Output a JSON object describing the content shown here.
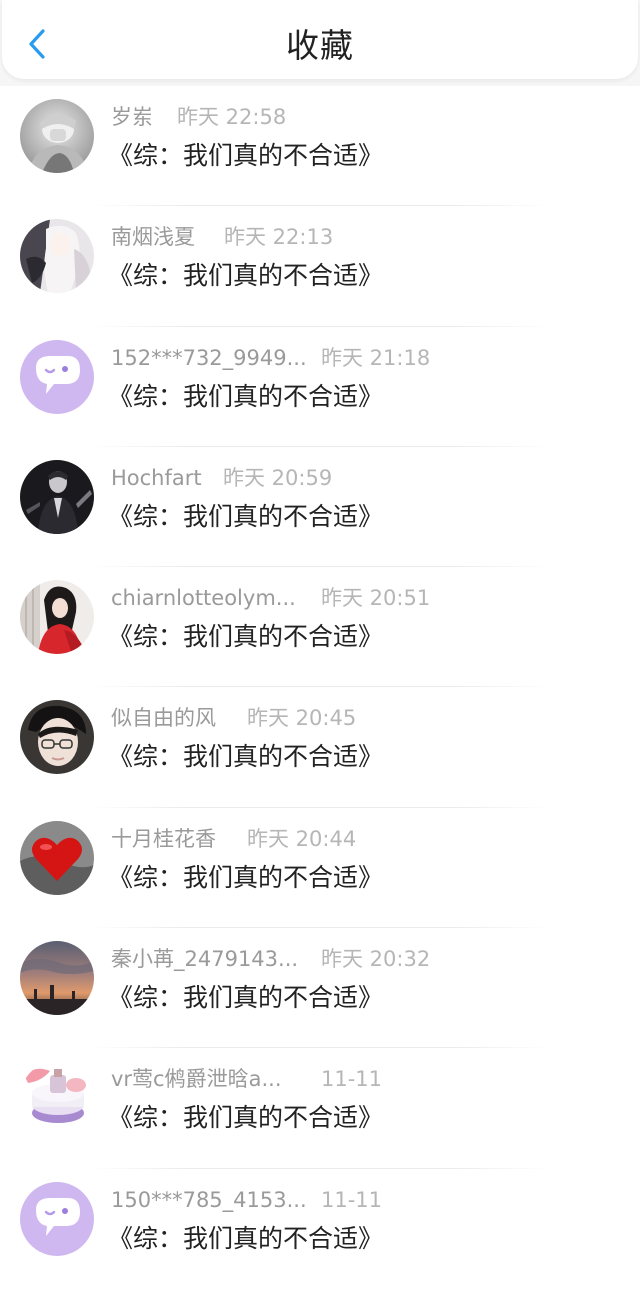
{
  "header": {
    "title": "收藏",
    "back_icon": "chevron-left-icon",
    "accent_color": "#2a9cf0"
  },
  "items": [
    {
      "user": "岁岽",
      "time": "昨天 22:58",
      "book": "《综：我们真的不合适》",
      "avatar": "photo-grey-hooded-figure"
    },
    {
      "user": "南烟浅夏",
      "time": "昨天 22:13",
      "book": "《综：我们真的不合适》",
      "avatar": "photo-anime-girl"
    },
    {
      "user": "152***732_9949...",
      "time": "昨天 21:18",
      "book": "《综：我们真的不合适》",
      "avatar": "default-chat-bubble-avatar"
    },
    {
      "user": "Hochfart",
      "time": "昨天 20:59",
      "book": "《综：我们真的不合适》",
      "avatar": "photo-dark-suited-man"
    },
    {
      "user": "chiarnlotteolym...",
      "time": "昨天 20:51",
      "book": "《综：我们真的不合适》",
      "avatar": "photo-girl-red-dress"
    },
    {
      "user": "似自由的风",
      "time": "昨天 20:45",
      "book": "《综：我们真的不合适》",
      "avatar": "photo-young-man-glasses"
    },
    {
      "user": "十月桂花香",
      "time": "昨天 20:44",
      "book": "《综：我们真的不合适》",
      "avatar": "photo-red-heart"
    },
    {
      "user": "秦小苒_2479143...",
      "time": "昨天 20:32",
      "book": "《综：我们真的不合适》",
      "avatar": "photo-sunset-sky"
    },
    {
      "user": "vr莺c鸺爵泄晗a...",
      "time": "11-11",
      "book": "《综：我们真的不合适》",
      "avatar": "photo-pink-cosmetics"
    },
    {
      "user": "150***785_4153...",
      "time": "11-11",
      "book": "《综：我们真的不合适》",
      "avatar": "default-chat-bubble-avatar"
    }
  ]
}
